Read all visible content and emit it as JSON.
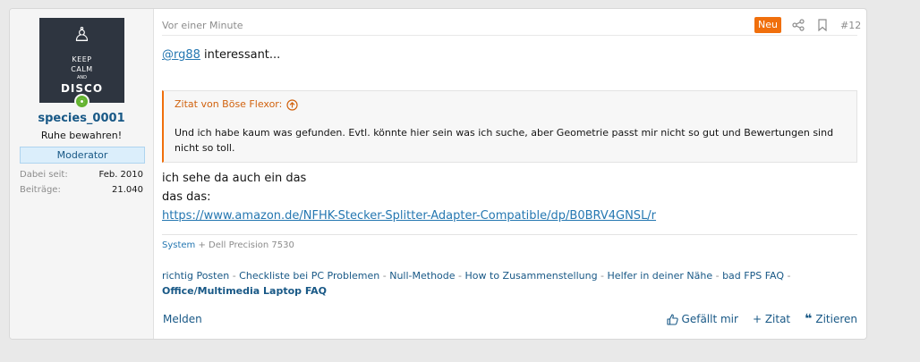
{
  "user": {
    "avatar_text": [
      "KEEP",
      "CALM",
      "AND",
      "DISCO"
    ],
    "username": "species_0001",
    "title": "Ruhe bewahren!",
    "role": "Moderator",
    "stats": [
      {
        "label": "Dabei seit:",
        "value": "Feb. 2010"
      },
      {
        "label": "Beiträge:",
        "value": "21.040"
      }
    ]
  },
  "post": {
    "date": "Vor einer Minute",
    "new_badge": "Neu",
    "number": "#12",
    "mention": "@rg88",
    "line1_text": " interessant...",
    "quote": {
      "header": "Zitat von Böse Flexor:",
      "body": "Und ich habe kaum was gefunden. Evtl. könnte hier sein was ich suche, aber Geometrie passt mir nicht so gut und Bewertungen sind nicht so toll."
    },
    "line2": "ich sehe da auch ein das",
    "line3": "das das:",
    "link": "https://www.amazon.de/NFHK-Stecker-Splitter-Adapter-Compatible/dp/B0BRV4GNSL/r"
  },
  "signature": {
    "system_label": "System",
    "system_value": "+ Dell Precision 7530",
    "links": [
      "richtig Posten",
      "Checkliste bei PC Problemen",
      "Null-Methode",
      "How to Zusammenstellung",
      "Helfer in deiner Nähe",
      "bad FPS FAQ"
    ],
    "separator": " - ",
    "bold_link": "Office/Multimedia Laptop FAQ"
  },
  "footer": {
    "report": "Melden",
    "like": "Gefällt mir",
    "quote_add": "+ Zitat",
    "quote": "Zitieren"
  },
  "colors": {
    "accent": "#185886",
    "link": "#2577b1",
    "new": "#f06f0c",
    "online": "#63b32f"
  }
}
